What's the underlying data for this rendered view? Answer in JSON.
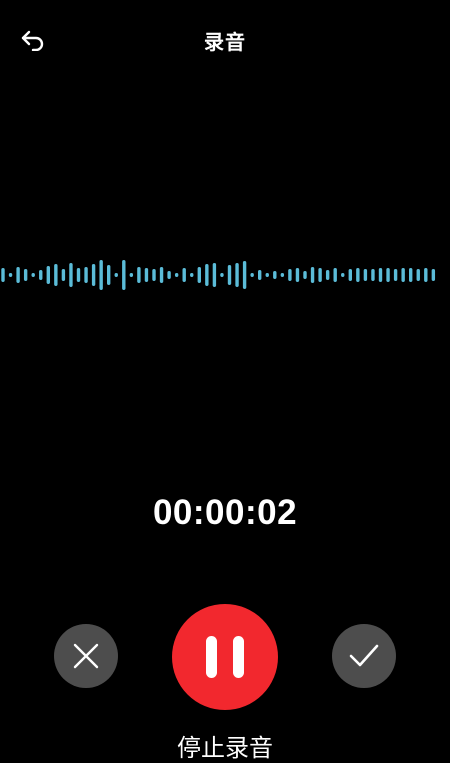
{
  "header": {
    "title": "录音",
    "back_icon": "back-arrow-icon"
  },
  "recording": {
    "elapsed": "00:00:02"
  },
  "controls": {
    "cancel_icon": "close-icon",
    "pause_icon": "pause-icon",
    "confirm_icon": "check-icon",
    "stop_label": "停止录音"
  },
  "waveform": {
    "amplitudes": [
      0.35,
      0.1,
      0.4,
      0.3,
      0.1,
      0.25,
      0.45,
      0.55,
      0.3,
      0.6,
      0.35,
      0.4,
      0.55,
      0.75,
      0.5,
      0.1,
      0.75,
      0.1,
      0.4,
      0.35,
      0.3,
      0.4,
      0.2,
      0.1,
      0.35,
      0.1,
      0.4,
      0.55,
      0.6,
      0.1,
      0.5,
      0.6,
      0.7,
      0.1,
      0.25,
      0.1,
      0.2,
      0.1,
      0.3,
      0.35,
      0.2,
      0.4,
      0.35,
      0.25,
      0.35,
      0.1,
      0.3,
      0.35,
      0.3,
      0.3,
      0.35,
      0.35,
      0.3,
      0.35,
      0.35,
      0.3,
      0.35,
      0.3
    ],
    "color": "#5bbcd8"
  },
  "colors": {
    "background": "#000000",
    "record_red": "#f2282e",
    "control_gray": "#4d4d4d",
    "text": "#ffffff"
  }
}
